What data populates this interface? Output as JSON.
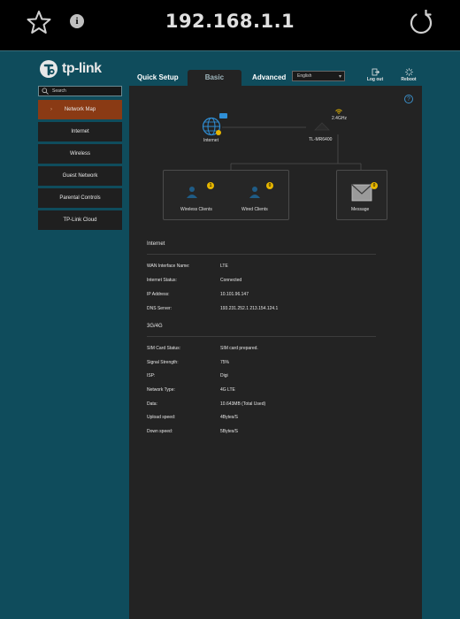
{
  "browser": {
    "url": "192.168.1.1",
    "star_icon": "star-icon",
    "info_icon": "info-icon",
    "info_glyph": "i",
    "reload_icon": "reload-icon"
  },
  "header": {
    "logo_text": "tp-link",
    "tabs": [
      {
        "label": "Quick Setup"
      },
      {
        "label": "Basic",
        "active": true
      },
      {
        "label": "Advanced"
      }
    ],
    "language": "English",
    "logout_label": "Log out",
    "reboot_label": "Reboot"
  },
  "sidebar": {
    "search_placeholder": "Search",
    "items": [
      {
        "label": "Network Map",
        "active": true
      },
      {
        "label": "Internet"
      },
      {
        "label": "Wireless"
      },
      {
        "label": "Guest Network"
      },
      {
        "label": "Parental Controls"
      },
      {
        "label": "TP-Link Cloud"
      }
    ]
  },
  "network_map": {
    "help_glyph": "?",
    "internet_label": "Internet",
    "band_label": "2.4GHz",
    "router_label": "TL-MR6400",
    "wireless_clients": {
      "label": "Wireless Clients",
      "count": "1"
    },
    "wired_clients": {
      "label": "Wired Clients",
      "count": "0"
    },
    "message": {
      "label": "Message",
      "count": "0"
    }
  },
  "internet_section": {
    "title": "Internet",
    "rows": [
      {
        "key": "WAN Interface Name:",
        "value": "LTE"
      },
      {
        "key": "Internet Status:",
        "value": "Connected"
      },
      {
        "key": "IP Address:",
        "value": "10.101.96.147"
      },
      {
        "key": "DNS Server:",
        "value": "193.231.252.1 213.154.124.1"
      }
    ]
  },
  "cellular_section": {
    "title": "3G/4G",
    "rows": [
      {
        "key": "SIM Card Status:",
        "value": "SIM card prepared."
      },
      {
        "key": "Signal Strength:",
        "value": "75%"
      },
      {
        "key": "ISP:",
        "value": "Digi"
      },
      {
        "key": "Network Type:",
        "value": "4G LTE"
      },
      {
        "key": "Data:",
        "value": "10.643MB (Total Used)"
      },
      {
        "key": "Upload speed:",
        "value": "4Bytes/S"
      },
      {
        "key": "Down speed:",
        "value": "5Bytes/S"
      }
    ]
  },
  "colors": {
    "page_bg": "#0f4c5c",
    "panel_bg": "#232323",
    "active_nav": "#8a3a14",
    "badge": "#e6b600"
  }
}
